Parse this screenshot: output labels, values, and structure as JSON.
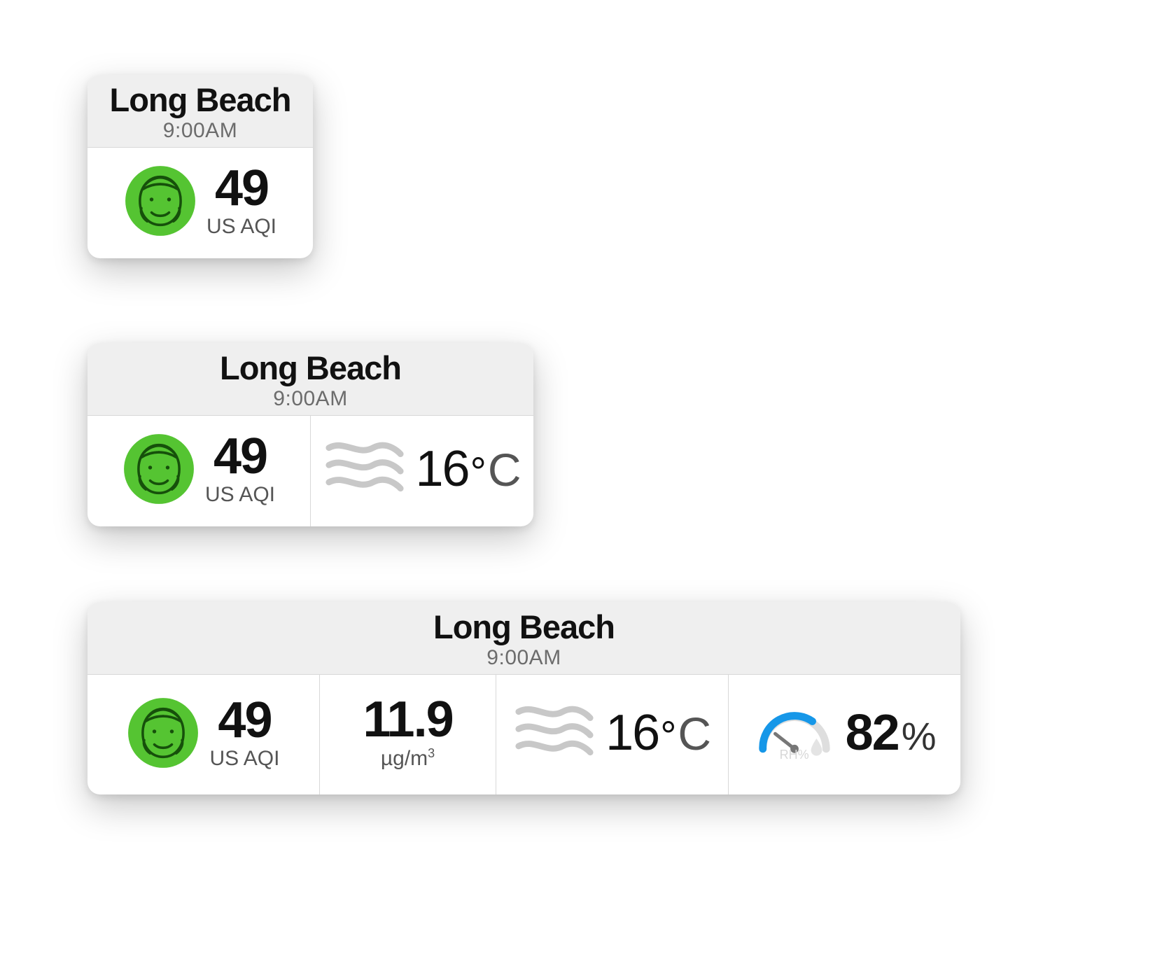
{
  "location": "Long Beach",
  "time": "9:00AM",
  "aqi": {
    "value": "49",
    "unit": "US AQI"
  },
  "pm": {
    "value": "11.9",
    "unit_prefix": "µg/m",
    "unit_sup": "3"
  },
  "temp": {
    "value": "16",
    "degree": "°",
    "unit": "C"
  },
  "humidity": {
    "value": "82",
    "unit": "%",
    "gauge_label": "RH%"
  },
  "colors": {
    "face_bg": "#55c432",
    "face_line": "#16500b",
    "wind": "#c8c8c8",
    "gauge_arc": "#1697e8",
    "gauge_bg": "#dedede"
  }
}
